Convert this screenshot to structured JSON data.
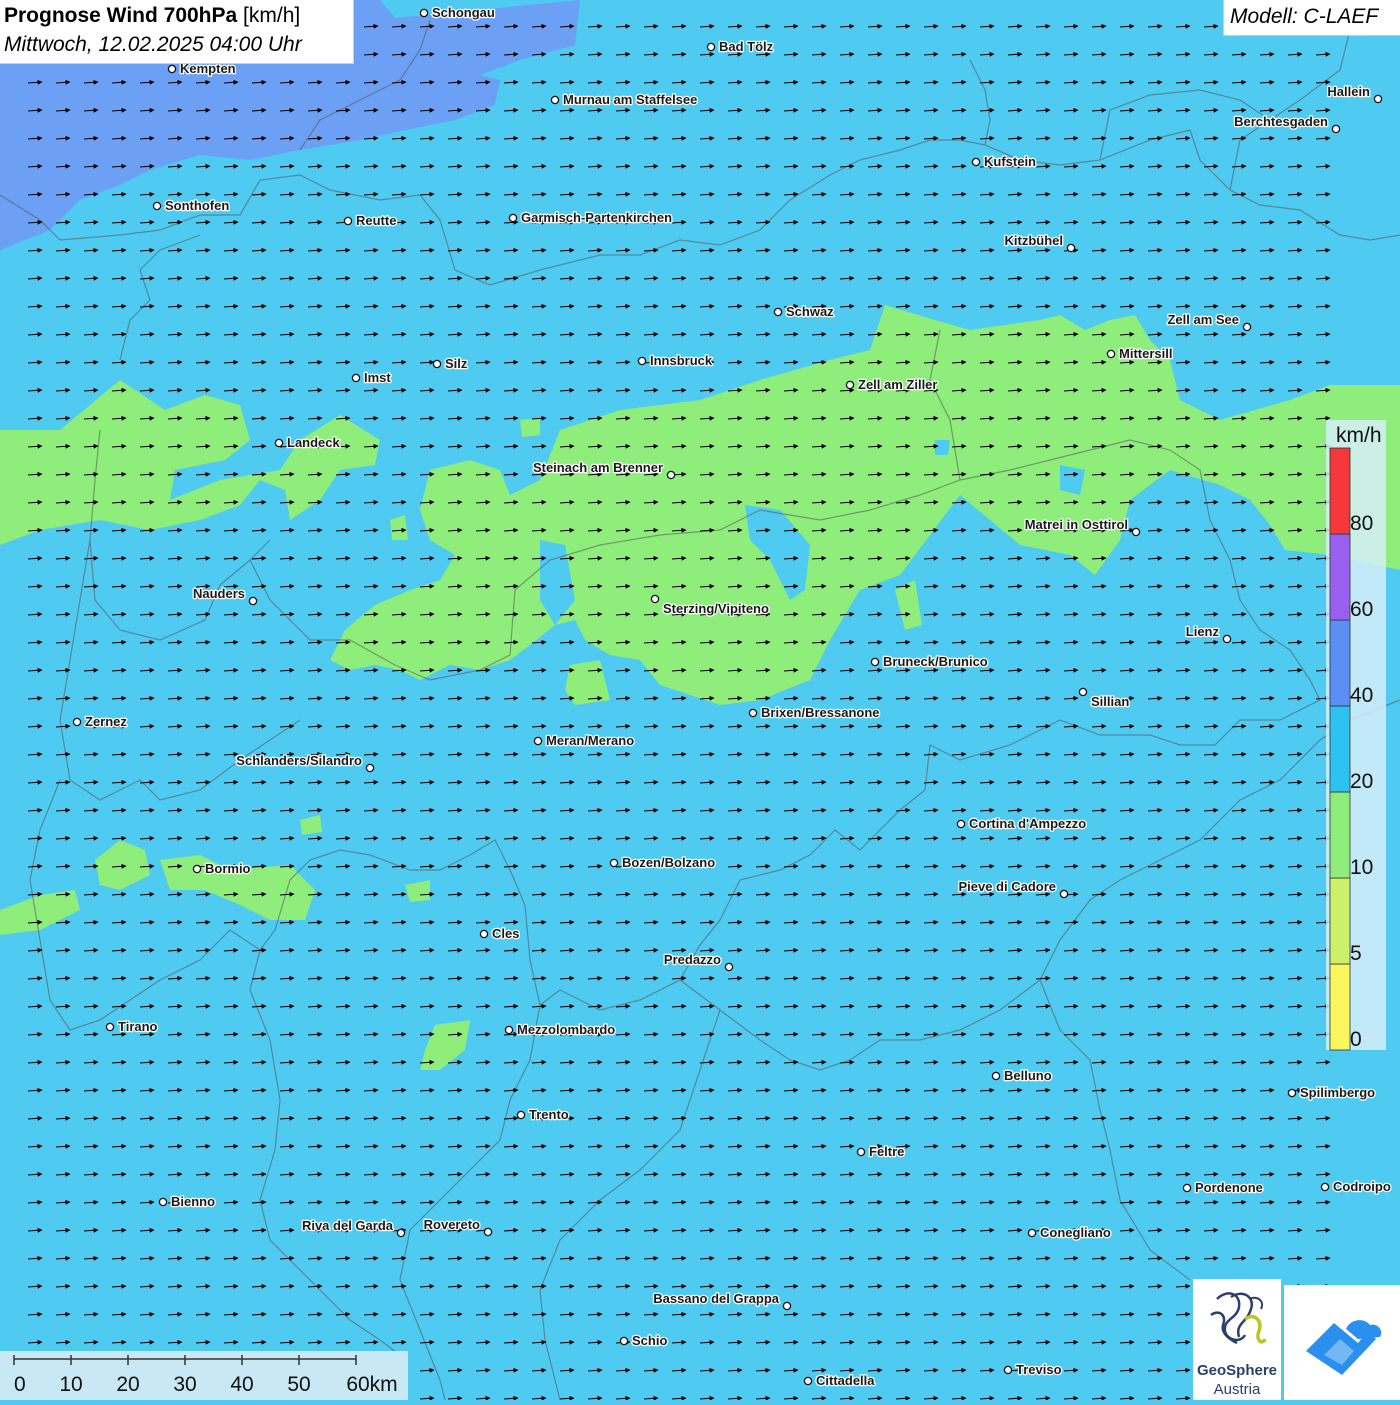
{
  "header": {
    "title_bold": "Prognose Wind 700hPa",
    "title_unit": "[km/h]",
    "subtitle": "Mittwoch, 12.02.2025 04:00 Uhr",
    "model": "Modell: C-LAEF"
  },
  "legend": {
    "unit": "km/h",
    "levels": [
      {
        "value": "0",
        "color": "#fbf65e"
      },
      {
        "value": "5",
        "color": "#ccf06a"
      },
      {
        "value": "10",
        "color": "#8fed7c"
      },
      {
        "value": "20",
        "color": "#2cc3f0"
      },
      {
        "value": "40",
        "color": "#5b8ff5"
      },
      {
        "value": "60",
        "color": "#9b5ff0"
      },
      {
        "value": "80",
        "color": "#f5383a"
      }
    ]
  },
  "scale_bar": {
    "ticks": [
      "0",
      "10",
      "20",
      "30",
      "40",
      "50",
      "60km"
    ]
  },
  "field_colors": {
    "base": "#4fcaf0",
    "moderate": "#8fed7c",
    "strong": "#6e9bf5",
    "border": "#555555",
    "arrow": "#000000"
  },
  "wind_direction": "east",
  "cities": [
    {
      "name": "Schongau"
    },
    {
      "name": "Kempten"
    },
    {
      "name": "Bad Tölz"
    },
    {
      "name": "Murnau am Staffelsee"
    },
    {
      "name": "Hallein"
    },
    {
      "name": "Berchtesgaden"
    },
    {
      "name": "Kufstein"
    },
    {
      "name": "Sonthofen"
    },
    {
      "name": "Reutte"
    },
    {
      "name": "Garmisch-Partenkirchen"
    },
    {
      "name": "Kitzbühel"
    },
    {
      "name": "Schwaz"
    },
    {
      "name": "Zell am See"
    },
    {
      "name": "Mittersill"
    },
    {
      "name": "Innsbruck"
    },
    {
      "name": "Silz"
    },
    {
      "name": "Imst"
    },
    {
      "name": "Zell am Ziller"
    },
    {
      "name": "Landeck"
    },
    {
      "name": "Steinach am Brenner"
    },
    {
      "name": "Matrei in Osttirol"
    },
    {
      "name": "Nauders"
    },
    {
      "name": "Sterzing/Vipiteno"
    },
    {
      "name": "Lienz"
    },
    {
      "name": "Bruneck/Brunico"
    },
    {
      "name": "Sillian"
    },
    {
      "name": "Brixen/Bressanone"
    },
    {
      "name": "Zernez"
    },
    {
      "name": "Meran/Merano"
    },
    {
      "name": "Schlanders/Silandro"
    },
    {
      "name": "Cortina d'Ampezzo"
    },
    {
      "name": "Bozen/Bolzano"
    },
    {
      "name": "Bormio"
    },
    {
      "name": "Pieve di Cadore"
    },
    {
      "name": "Cles"
    },
    {
      "name": "Predazzo"
    },
    {
      "name": "Tirano"
    },
    {
      "name": "Mezzolombardo"
    },
    {
      "name": "Belluno"
    },
    {
      "name": "Spilimbergo"
    },
    {
      "name": "Trento"
    },
    {
      "name": "Feltre"
    },
    {
      "name": "Bienno"
    },
    {
      "name": "Pordenone"
    },
    {
      "name": "Codroipo"
    },
    {
      "name": "Riva del Garda"
    },
    {
      "name": "Rovereto"
    },
    {
      "name": "Conegliano"
    },
    {
      "name": "Bassano del Grappa"
    },
    {
      "name": "Schio"
    },
    {
      "name": "Treviso"
    },
    {
      "name": "Cittadella"
    }
  ],
  "logos": {
    "geosphere_line1": "GeoSphere",
    "geosphere_line2": "Austria"
  }
}
